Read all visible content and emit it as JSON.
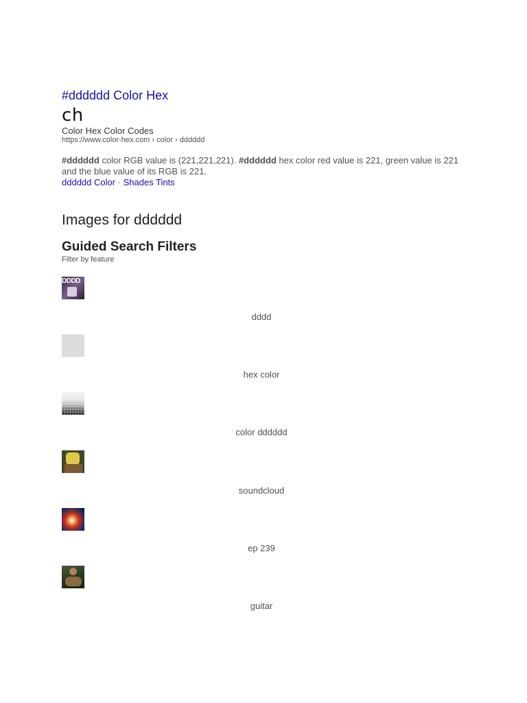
{
  "result": {
    "title": "#dddddd Color Hex",
    "logo_text": "ch",
    "site_name": "Color Hex Color Codes",
    "url": "https://www.color-hex.com › color › dddddd",
    "snippet": {
      "bold_1": "#dddddd",
      "text_1": " color RGB value is (221,221,221). ",
      "bold_2": "#dddddd",
      "text_2": " hex color red value is 221, green value is 221 and the blue value of its RGB is 221."
    },
    "sitelinks": [
      {
        "label": "dddddd Color"
      },
      {
        "label": "Shades Tints"
      }
    ],
    "sitelink_separator": " · "
  },
  "images_section": {
    "heading": "Images for dddddd"
  },
  "guided_filters": {
    "heading": "Guided Search Filters",
    "subheading": "Filter by feature",
    "items": [
      {
        "label": "dddd",
        "thumb_text": "DDDD"
      },
      {
        "label": "hex color",
        "thumb_color": "#dddddd"
      },
      {
        "label": "color dddddd"
      },
      {
        "label": "soundcloud"
      },
      {
        "label": "ep 239"
      },
      {
        "label": "guitar"
      }
    ]
  },
  "colors": {
    "link": "#1a0dab",
    "snippet_text": "#4d5156",
    "heading_text": "#202124"
  }
}
